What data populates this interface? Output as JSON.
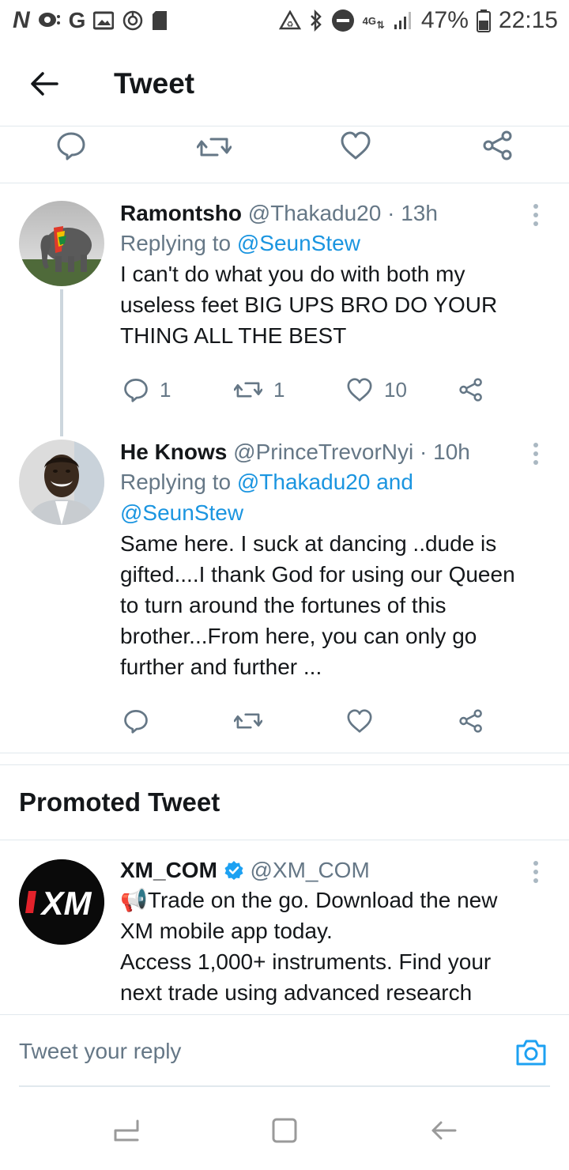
{
  "status_bar": {
    "left_icons": [
      "N",
      "G"
    ],
    "battery": "47%",
    "time": "22:15",
    "network": "4G"
  },
  "header": {
    "title": "Tweet"
  },
  "tweets": [
    {
      "name": "Ramontsho",
      "handle": "@Thakadu20",
      "time": "· 13h",
      "replying_label": "Replying to",
      "replying_to": "@SeunStew",
      "lines": [
        "I can't do what you do with both my",
        "useless feet BIG UPS BRO DO YOUR",
        "THING ALL THE BEST"
      ],
      "reply_count": "1",
      "retweet_count": "1",
      "like_count": "10"
    },
    {
      "name": "He Knows",
      "handle": "@PrinceTrevorNyi",
      "time": "· 10h",
      "replying_label": "Replying to",
      "replying_to_line1": "@Thakadu20 and",
      "replying_to_line2": "@SeunStew",
      "lines": [
        "Same here. I suck at dancing ..dude is",
        "gifted....I thank God  for using our Queen",
        "to turn around the fortunes of this",
        "brother...From here, you can only go",
        "further and further ..."
      ]
    }
  ],
  "promoted": {
    "title": "Promoted Tweet",
    "name": "XM_COM",
    "handle": "@XM_COM",
    "avatar_text": "XM",
    "lines": [
      "Trade on the go. Download the new",
      "XM mobile app today.",
      "Access 1,000+ instruments. Find your",
      "next trade using advanced research"
    ],
    "megaphone": "📢"
  },
  "composer": {
    "placeholder": "Tweet your reply"
  },
  "colors": {
    "link": "#1b95e0",
    "secondary": "#657786",
    "text": "#14171a",
    "divider": "#e1e8ed"
  }
}
